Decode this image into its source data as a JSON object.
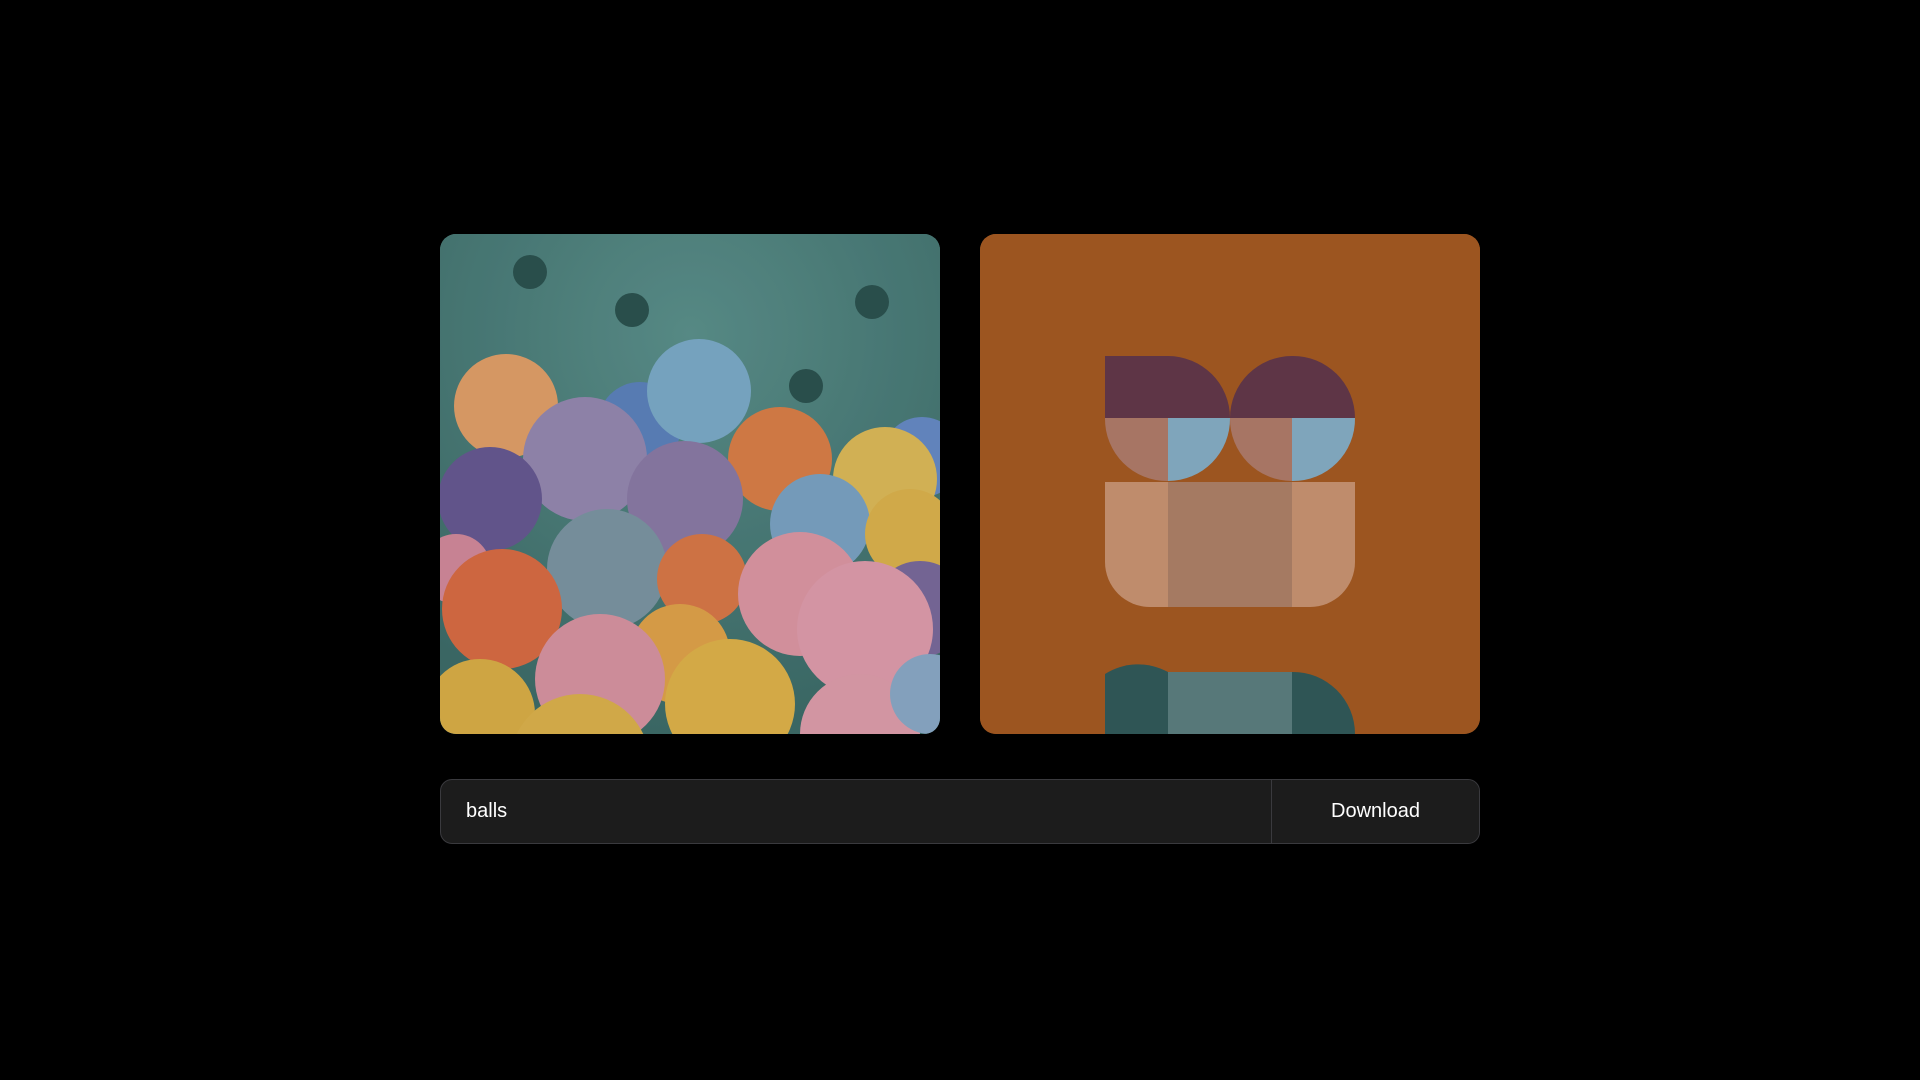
{
  "images": {
    "photo": {
      "subject": "ball-pit-photo"
    },
    "generated": {
      "subject": "geometric-face-avatar"
    }
  },
  "prompt": {
    "value": "balls",
    "placeholder": ""
  },
  "actions": {
    "download_label": "Download"
  },
  "colors": {
    "background": "#000000",
    "bar_background": "#1c1c1c",
    "bar_border": "#3a3a3e",
    "art_background": "#9c5520",
    "photo_background": "#4f8580"
  }
}
